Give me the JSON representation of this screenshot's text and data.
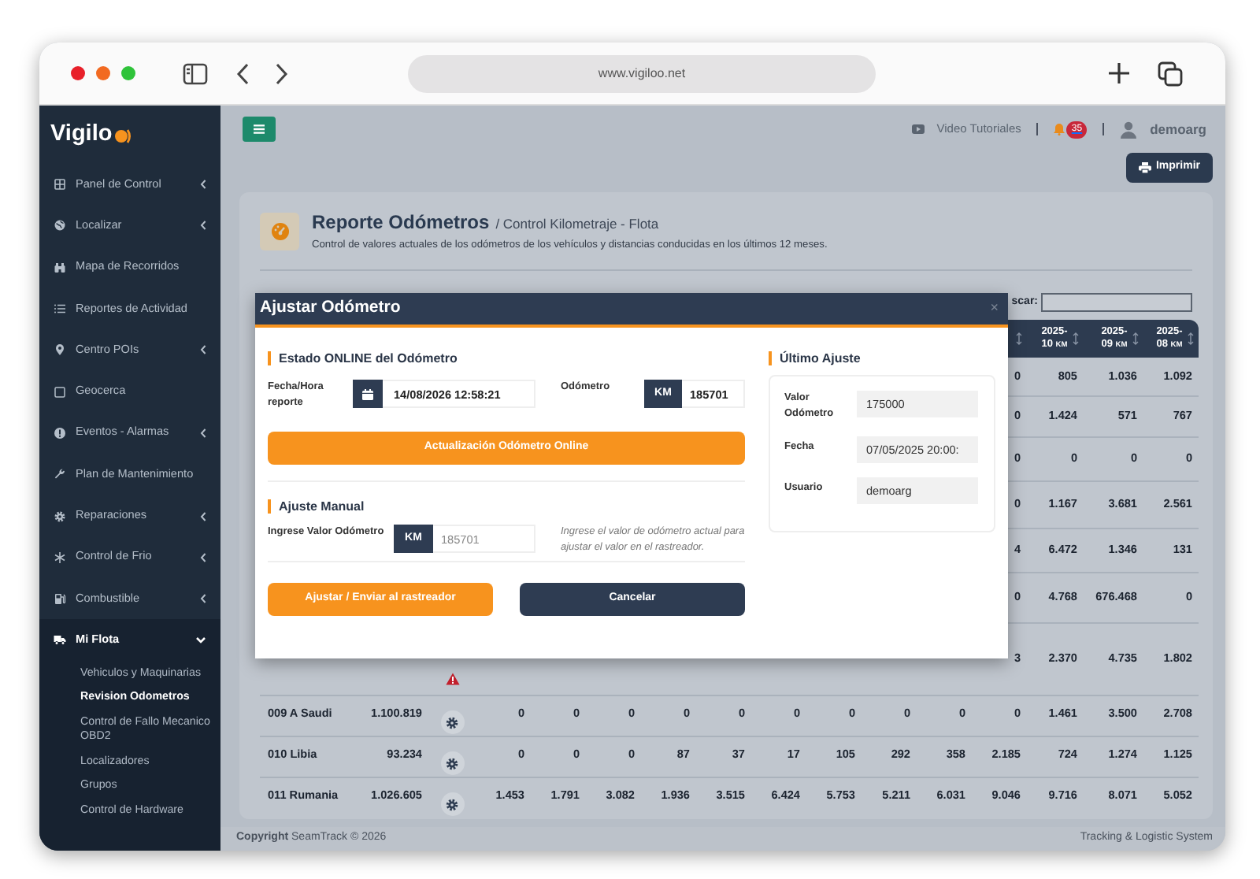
{
  "browser": {
    "url": "www.vigiloo.net"
  },
  "sidebar": {
    "logo": "Vigilo",
    "items": [
      {
        "label": "Panel de Control",
        "submenu": true,
        "expanded": false
      },
      {
        "label": "Localizar",
        "submenu": true,
        "expanded": false
      },
      {
        "label": "Mapa de Recorridos",
        "submenu": false,
        "expanded": false
      },
      {
        "label": "Reportes de Actividad",
        "submenu": false,
        "expanded": false
      },
      {
        "label": "Centro POIs",
        "submenu": true,
        "expanded": false
      },
      {
        "label": "Geocerca",
        "submenu": false,
        "expanded": false
      },
      {
        "label": "Eventos - Alarmas",
        "submenu": true,
        "expanded": false
      },
      {
        "label": "Plan de Mantenimiento",
        "submenu": false,
        "expanded": false
      },
      {
        "label": "Reparaciones",
        "submenu": true,
        "expanded": false
      },
      {
        "label": "Control de Frio",
        "submenu": true,
        "expanded": false
      },
      {
        "label": "Combustible",
        "submenu": true,
        "expanded": false
      },
      {
        "label": "Mi Flota",
        "submenu": true,
        "expanded": true,
        "children": [
          {
            "label": "Vehiculos y Maquinarias",
            "selected": false
          },
          {
            "label": "Revision Odometros",
            "selected": true
          },
          {
            "label": "Control de Fallo Mecanico OBD2",
            "selected": false
          },
          {
            "label": "Localizadores",
            "selected": false
          },
          {
            "label": "Grupos",
            "selected": false
          },
          {
            "label": "Control de Hardware",
            "selected": false
          }
        ]
      }
    ]
  },
  "topbar": {
    "video": "Video Tutoriales",
    "notifications": "35",
    "user": "demoarg",
    "print": "Imprimir"
  },
  "report": {
    "title": "Reporte Odómetros",
    "subtitle": "/ Control Kilometraje - Flota",
    "description": "Control de valores actuales de los odómetros de los vehículos y distancias conducidas en los últimos 12 meses."
  },
  "table": {
    "search_label": "scar:",
    "columns": [
      {
        "kind": "sort"
      },
      {
        "kind": "month",
        "label": "2025-10",
        "unit": "KM"
      },
      {
        "kind": "month",
        "label": "2025-09",
        "unit": "KM"
      },
      {
        "kind": "month",
        "label": "2025-08",
        "unit": "KM"
      }
    ],
    "rows": [
      {
        "kind": "covered",
        "alert": false,
        "cells": [
          "0",
          "805",
          "1.036",
          "1.092"
        ]
      },
      {
        "kind": "covered",
        "alert": false,
        "cells": [
          "0",
          "1.424",
          "571",
          "767"
        ]
      },
      {
        "kind": "covered",
        "alert": false,
        "cells": [
          "0",
          "0",
          "0",
          "0"
        ]
      },
      {
        "kind": "covered",
        "alert": false,
        "cells": [
          "0",
          "1.167",
          "3.681",
          "2.561"
        ]
      },
      {
        "kind": "covered",
        "alert": false,
        "cells": [
          "4",
          "6.472",
          "1.346",
          "131"
        ]
      },
      {
        "kind": "covered",
        "alert": false,
        "cells": [
          "0",
          "4.768",
          "676.468",
          "0"
        ]
      },
      {
        "kind": "covered",
        "alert": true,
        "cells": [
          "3",
          "2.370",
          "4.735",
          "1.802"
        ]
      },
      {
        "kind": "vehicle",
        "name": "009 A Saudi",
        "total": "1.100.819",
        "cells": [
          "0",
          "0",
          "0",
          "0",
          "0",
          "0",
          "0",
          "0",
          "0",
          "0",
          "1.461",
          "3.500",
          "2.708"
        ]
      },
      {
        "kind": "vehicle",
        "name": "010 Libia",
        "total": "93.234",
        "cells": [
          "0",
          "0",
          "0",
          "87",
          "37",
          "17",
          "105",
          "292",
          "358",
          "2.185",
          "724",
          "1.274",
          "1.125"
        ]
      },
      {
        "kind": "vehicle",
        "name": "011 Rumania",
        "total": "1.026.605",
        "cells": [
          "1.453",
          "1.791",
          "3.082",
          "1.936",
          "3.515",
          "6.424",
          "5.753",
          "5.211",
          "6.031",
          "9.046",
          "9.716",
          "8.071",
          "5.052"
        ]
      }
    ]
  },
  "modal": {
    "title": "Ajustar Odómetro",
    "close": "×",
    "online": {
      "heading": "Estado ONLINE del Odómetro",
      "date_label": "Fecha/Hora reporte",
      "date_value": "14/08/2026 12:58:21",
      "odo_label": "Odómetro",
      "unit": "KM",
      "odo_value": "185701",
      "button": "Actualización Odómetro Online"
    },
    "manual": {
      "heading": "Ajuste Manual",
      "label": "Ingrese Valor Odómetro",
      "unit": "KM",
      "placeholder": "185701",
      "help": "Ingrese el valor de odómetro actual para ajustar el valor en el rastreador."
    },
    "last": {
      "heading": "Último Ajuste",
      "fields": [
        {
          "label": "Valor Odómetro",
          "value": "175000"
        },
        {
          "label": "Fecha",
          "value": "07/05/2025 20:00:"
        },
        {
          "label": "Usuario",
          "value": "demoarg"
        }
      ]
    },
    "buttons": [
      {
        "label": "Ajustar / Enviar al rastreador",
        "kind": "primary"
      },
      {
        "label": "Cancelar",
        "kind": "secondary"
      }
    ]
  },
  "footer": {
    "left": "**Copyright** SeamTrack © 2026",
    "right": "Tracking & Logistic System"
  }
}
